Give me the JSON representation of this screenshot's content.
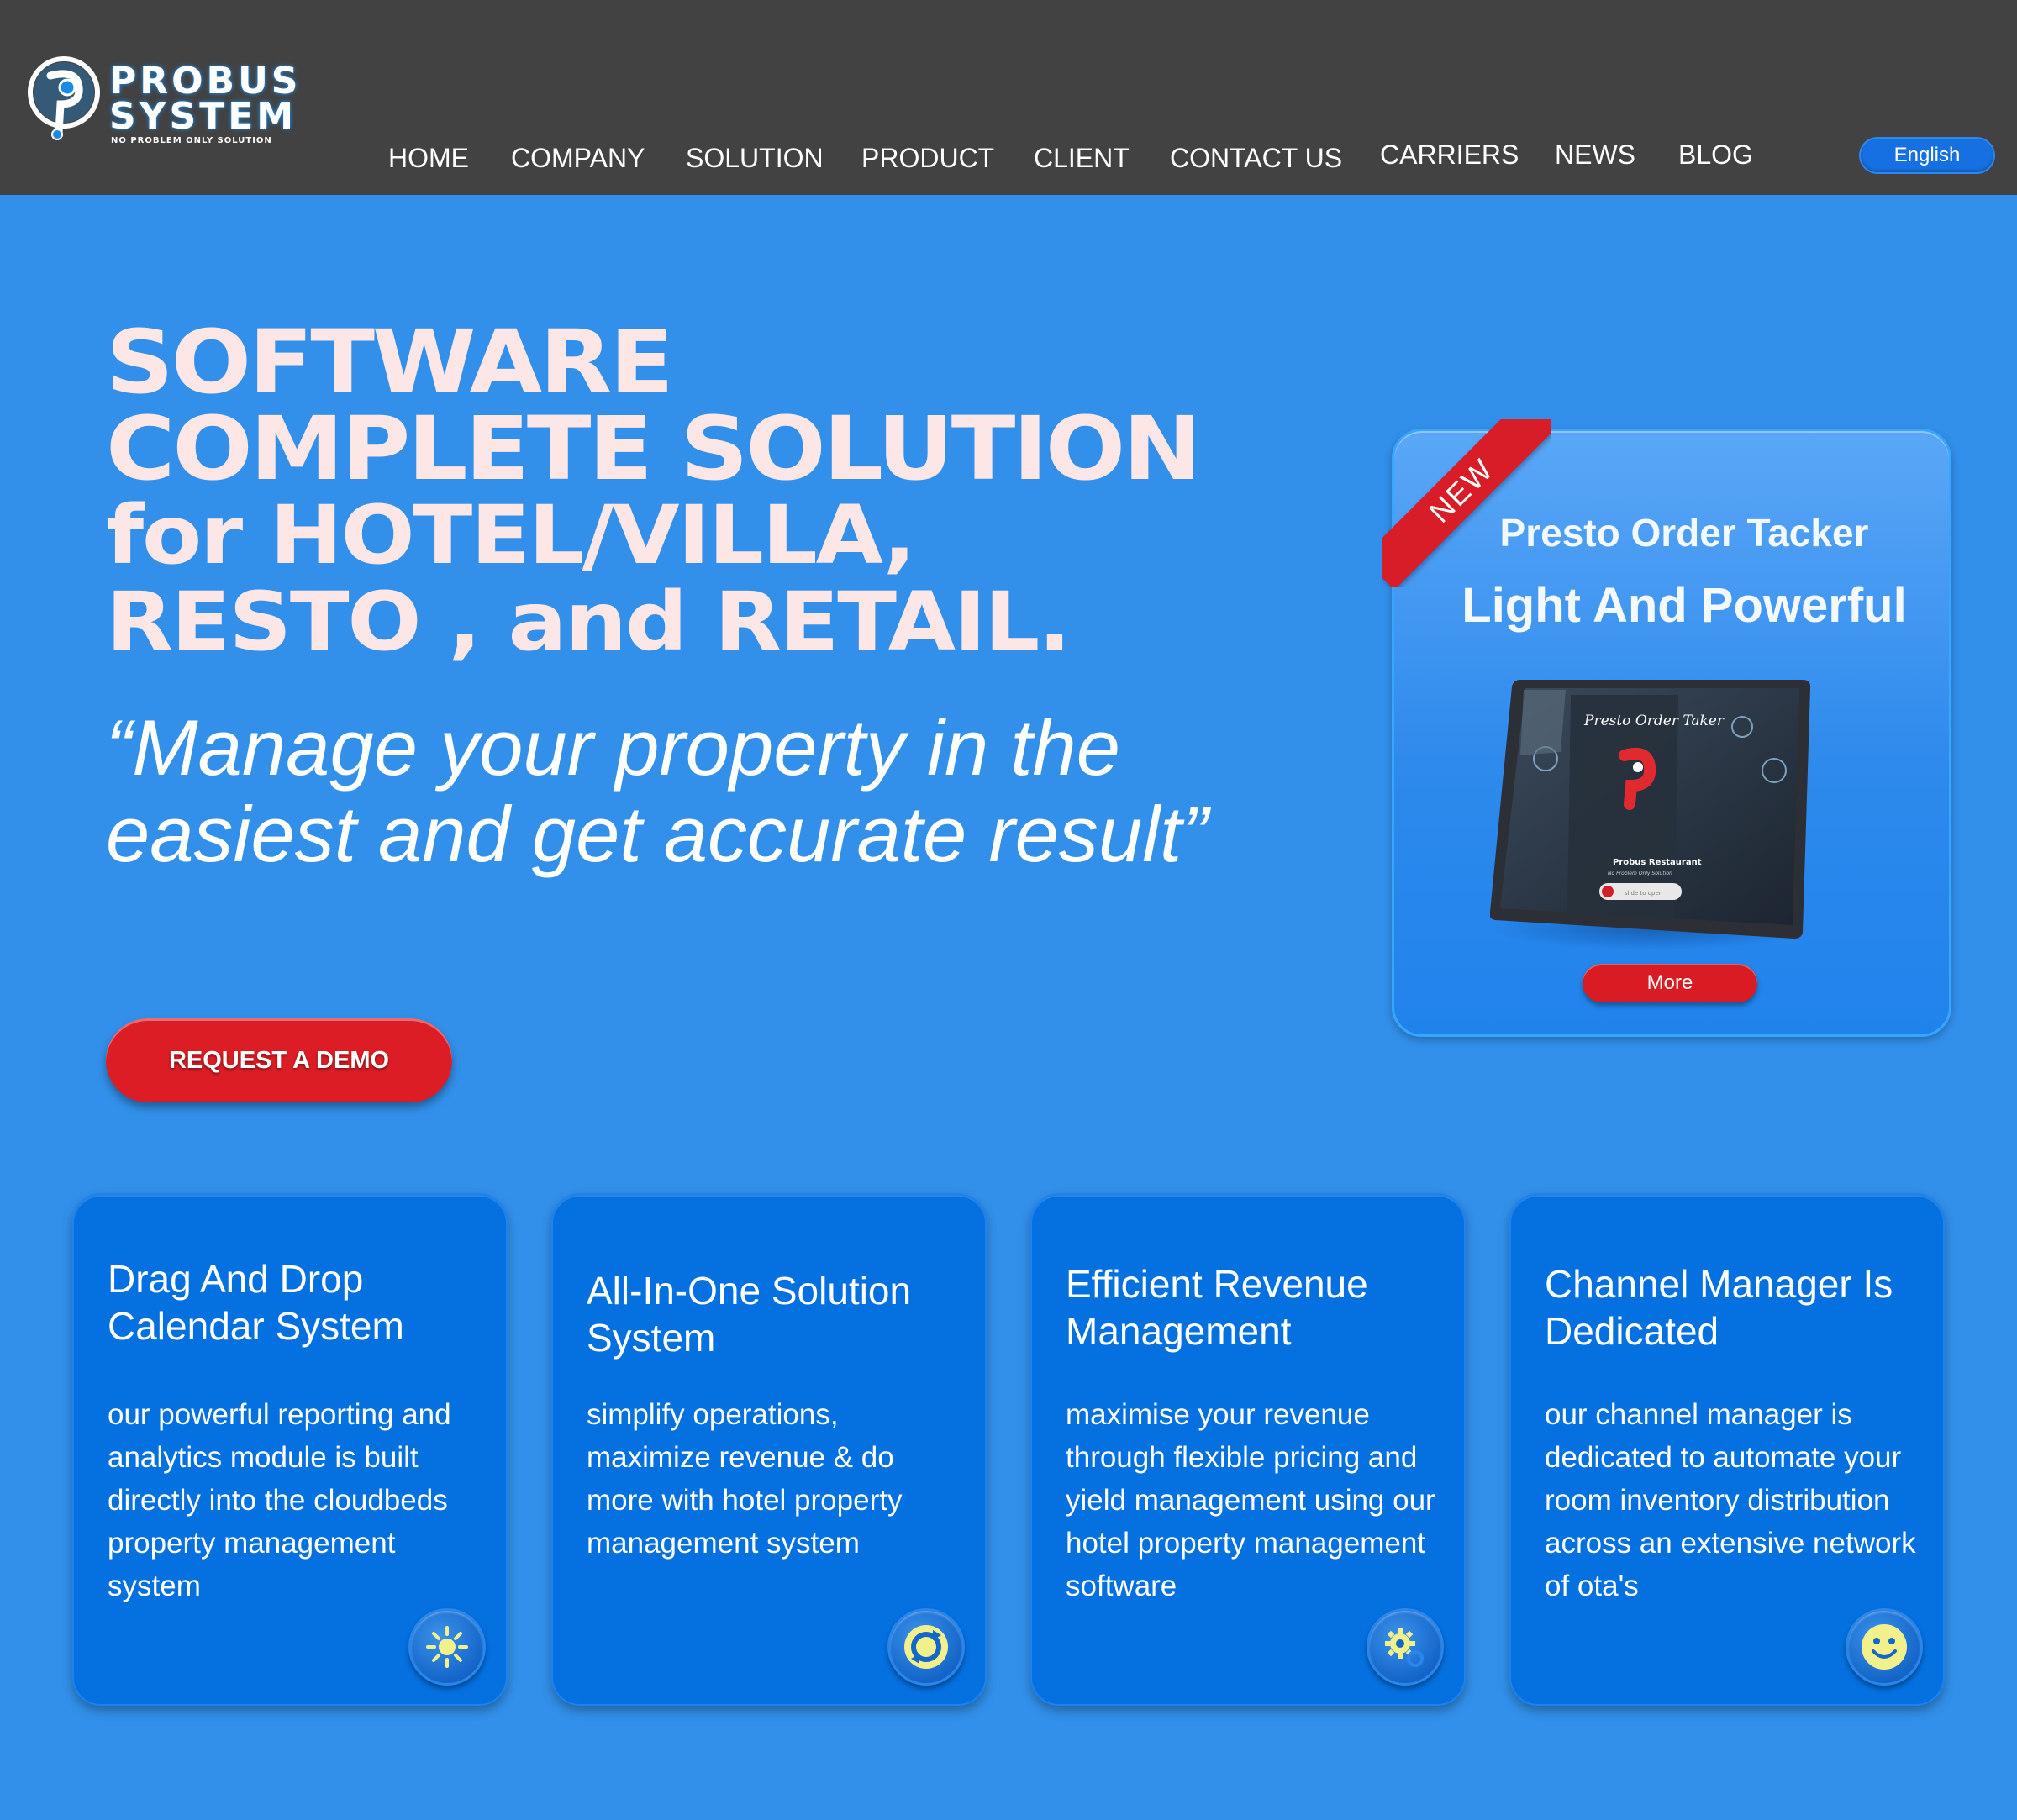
{
  "header": {
    "logo": {
      "name_line1": "PROBUS",
      "name_line2": "SYSTEM",
      "tagline": "NO PROBLEM ONLY SOLUTION"
    },
    "nav": [
      {
        "label": "HOME"
      },
      {
        "label": "COMPANY"
      },
      {
        "label": "SOLUTION"
      },
      {
        "label": "PRODUCT"
      },
      {
        "label": "CLIENT"
      },
      {
        "label": "CONTACT US"
      },
      {
        "label": "CARRIERS"
      },
      {
        "label": "NEWS"
      },
      {
        "label": "BLOG"
      }
    ],
    "language": "English"
  },
  "hero": {
    "title_line1": "SOFTWARE",
    "title_line2": "COMPLETE SOLUTION",
    "title_line3": "for HOTEL/VILLA,",
    "title_line4": "RESTO , and RETAIL.",
    "quote": "“Manage your property in the easiest and get accurate result”",
    "cta_label": "REQUEST A DEMO"
  },
  "product_card": {
    "ribbon": "NEW",
    "title": "Presto Order Tacker",
    "subtitle": "Light And Powerful",
    "more_label": "More",
    "screen": {
      "app_name": "Presto Order Taker",
      "restaurant": "Probus Restaurant",
      "restaurant_tagline": "No Problem Only Solution",
      "slider_text": "slide to open"
    }
  },
  "features": [
    {
      "title": "Drag And Drop Calendar System",
      "description": "our powerful reporting and analytics module is built directly into the cloudbeds property management system",
      "icon": "sun-icon"
    },
    {
      "title": "All-In-One Solution System",
      "description": "simplify operations, maximize revenue & do more with hotel property management system",
      "icon": "refresh-icon"
    },
    {
      "title": "Efficient Revenue Management",
      "description": "maximise your revenue through flexible pricing and yield management using our hotel property management software",
      "icon": "gears-icon"
    },
    {
      "title": "Channel Manager Is Dedicated",
      "description": "our channel manager is dedicated to automate your room inventory distribution across an extensive network of ota's",
      "icon": "smiley-icon"
    }
  ],
  "colors": {
    "page_bg": "#3290ea",
    "header_bg": "#424242",
    "card_bg": "#0570e0",
    "accent_red": "#dd1d25",
    "title_pink": "#fde6e6",
    "icon_yellow": "#f2f08a"
  }
}
